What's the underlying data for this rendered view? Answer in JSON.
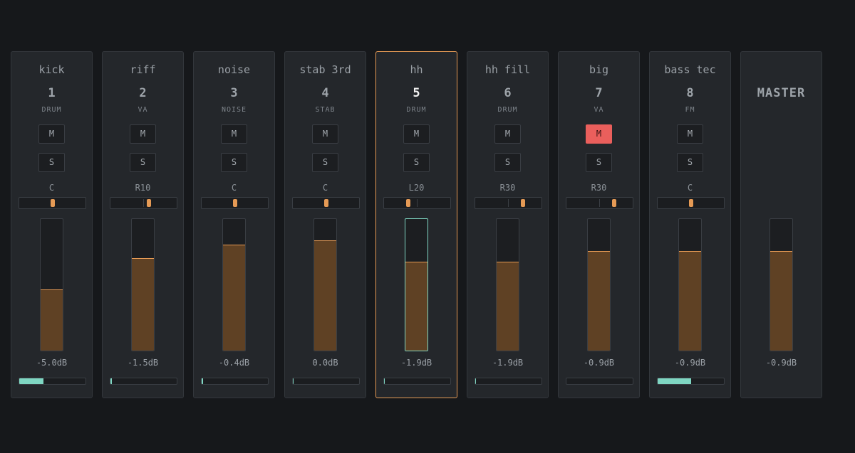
{
  "channels": [
    {
      "name": "kick",
      "number": "1",
      "type": "DRUM",
      "mute": "M",
      "solo": "S",
      "muted": false,
      "pan_label": "C",
      "pan": 0,
      "fader_level": 0.46,
      "db": "-5.0dB",
      "meter_level": 0.37,
      "selected": false
    },
    {
      "name": "riff",
      "number": "2",
      "type": "VA",
      "mute": "M",
      "solo": "S",
      "muted": false,
      "pan_label": "R10",
      "pan": 0.1,
      "fader_level": 0.7,
      "db": "-1.5dB",
      "meter_level": 0.02,
      "selected": false
    },
    {
      "name": "noise",
      "number": "3",
      "type": "NOISE",
      "mute": "M",
      "solo": "S",
      "muted": false,
      "pan_label": "C",
      "pan": 0,
      "fader_level": 0.8,
      "db": "-0.4dB",
      "meter_level": 0.02,
      "selected": false
    },
    {
      "name": "stab 3rd",
      "number": "4",
      "type": "STAB",
      "mute": "M",
      "solo": "S",
      "muted": false,
      "pan_label": "C",
      "pan": 0,
      "fader_level": 0.83,
      "db": "0.0dB",
      "meter_level": 0.01,
      "selected": false
    },
    {
      "name": "hh",
      "number": "5",
      "type": "DRUM",
      "mute": "M",
      "solo": "S",
      "muted": false,
      "pan_label": "L20",
      "pan": -0.2,
      "fader_level": 0.67,
      "db": "-1.9dB",
      "meter_level": 0.01,
      "selected": true
    },
    {
      "name": "hh fill",
      "number": "6",
      "type": "DRUM",
      "mute": "M",
      "solo": "S",
      "muted": false,
      "pan_label": "R30",
      "pan": 0.3,
      "fader_level": 0.67,
      "db": "-1.9dB",
      "meter_level": 0.01,
      "selected": false
    },
    {
      "name": "big",
      "number": "7",
      "type": "VA",
      "mute": "M",
      "solo": "S",
      "muted": true,
      "pan_label": "R30",
      "pan": 0.3,
      "fader_level": 0.75,
      "db": "-0.9dB",
      "meter_level": 0,
      "selected": false
    },
    {
      "name": "bass tec",
      "number": "8",
      "type": "FM",
      "mute": "M",
      "solo": "S",
      "muted": false,
      "pan_label": "C",
      "pan": 0,
      "fader_level": 0.75,
      "db": "-0.9dB",
      "meter_level": 0.5,
      "selected": false
    }
  ],
  "master": {
    "label": "MASTER",
    "fader_level": 0.75,
    "db": "-0.9dB"
  },
  "colors": {
    "accent": "#e59a55",
    "selected_fader": "#7fd6c2",
    "mute_active": "#ea5f5c",
    "meter": "#7fd6c2",
    "fader_fill": "#5f4124"
  }
}
